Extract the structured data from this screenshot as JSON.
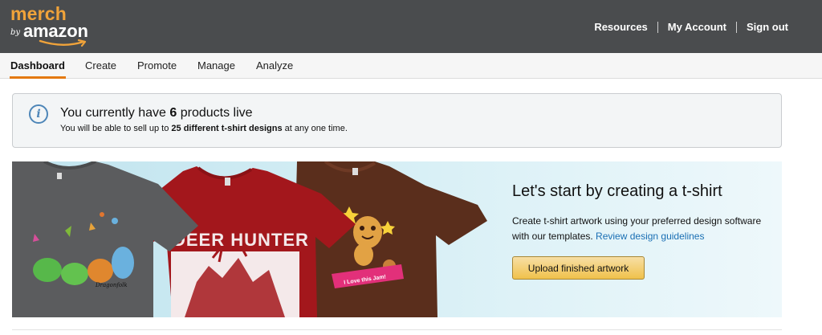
{
  "brand": {
    "line1": "merch",
    "by": "by",
    "line2": "amazon",
    "colors": {
      "merch": "#f0a33a",
      "header_bg": "#4a4c4e",
      "accent": "#e47911",
      "link": "#1a6fb4"
    }
  },
  "header": {
    "links": [
      "Resources",
      "My Account",
      "Sign out"
    ]
  },
  "nav": {
    "items": [
      "Dashboard",
      "Create",
      "Promote",
      "Manage",
      "Analyze"
    ],
    "active": "Dashboard"
  },
  "info": {
    "icon": "info-icon",
    "title_prefix": "You currently have ",
    "title_count": "6",
    "title_suffix": " products live",
    "sub_prefix": "You will be able to sell up to ",
    "sub_bold": "25 different t-shirt designs",
    "sub_suffix": " at any one time."
  },
  "hero": {
    "title": "Let's start by creating a t-shirt",
    "body": "Create t-shirt artwork using your preferred design software with our templates. ",
    "link": "Review design guidelines",
    "button": "Upload finished artwork",
    "shirt_texts": {
      "red": "DEER HUNTER",
      "brown_banner": "I Love this Jam!",
      "gray_signature": "Dragonfolk"
    }
  }
}
